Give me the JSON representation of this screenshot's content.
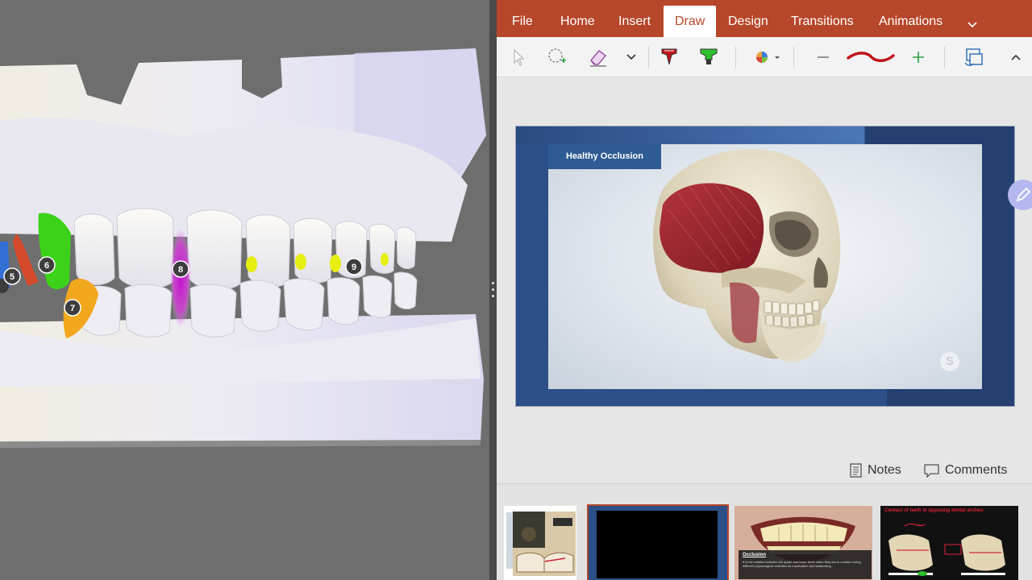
{
  "ribbon": {
    "tabs": [
      {
        "label": "File"
      },
      {
        "label": "Home"
      },
      {
        "label": "Insert"
      },
      {
        "label": "Draw"
      },
      {
        "label": "Design"
      },
      {
        "label": "Transitions"
      },
      {
        "label": "Animations"
      }
    ],
    "active_tab": "Draw",
    "accent_color": "#b7472a"
  },
  "draw_toolbar": {
    "tools": [
      "select-arrow-icon",
      "lasso-select-icon",
      "eraser-icon",
      "more-pens-chevron-icon",
      "red-pen-icon",
      "green-highlighter-icon",
      "color-palette-icon",
      "thickness-decrease-icon",
      "ink-stroke-preview",
      "thickness-increase-icon",
      "ink-to-shape-icon",
      "collapse-ribbon-icon"
    ],
    "pen_color": "#c0141c",
    "highlighter_color": "#2fbf2f"
  },
  "slide": {
    "title": "Healthy Occlusion",
    "logo_letter": "S"
  },
  "status": {
    "notes_label": "Notes",
    "comments_label": "Comments"
  },
  "viewer": {
    "tooth_markers": [
      "5",
      "6",
      "7",
      "8",
      "9"
    ],
    "marker_colors": {
      "6": "#3cd21a",
      "7": "#f2a81c",
      "8": "#cc1fd2",
      "9": "#e6ee12",
      "5": "#e4421c"
    }
  },
  "thumbnails": {
    "thumb3_title": "Occlusion",
    "thumb3_text": "It is the relation between the upper and lower teeth when they are in contact during different physiological activities as mastication and swallowing",
    "thumb4_title": "Contact of teeth in opposing dental arches:"
  }
}
